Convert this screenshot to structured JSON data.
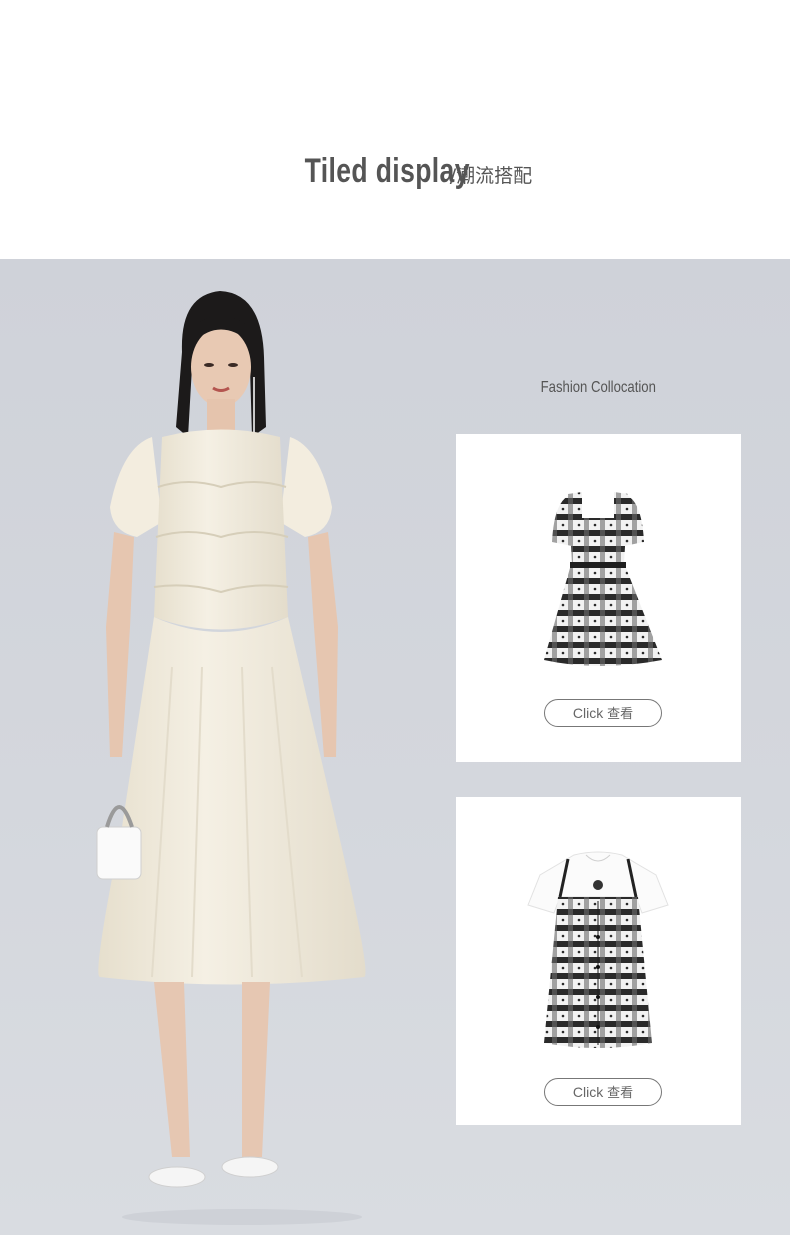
{
  "header": {
    "title_en": "Tiled display",
    "separator": "/",
    "title_cn": "潮流搭配"
  },
  "showcase": {
    "model_image": "model-in-cream-puff-sleeve-dress",
    "collocation_label": "Fashion Collocation",
    "products": [
      {
        "image": "black-white-plaid-square-neck-dress",
        "click_label": "Click",
        "click_label_cn": "查看"
      },
      {
        "image": "white-tee-with-plaid-pinafore-dress",
        "click_label": "Click",
        "click_label_cn": "查看"
      }
    ]
  },
  "colors": {
    "background_gray": "#d2d5db",
    "text_gray": "#555555",
    "dress_cream": "#f1ebdc",
    "plaid_dark": "#2a2a2a"
  }
}
